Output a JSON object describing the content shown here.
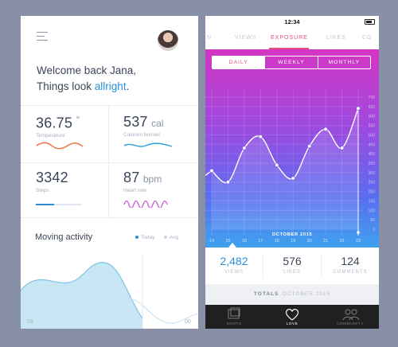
{
  "left": {
    "welcome_line1": "Welcome back Jana,",
    "welcome_line2_prefix": "Things look ",
    "welcome_line2_accent": "allright",
    "welcome_line2_suffix": ".",
    "metrics": [
      {
        "value": "36.75",
        "unit": "°",
        "label": "Temperature"
      },
      {
        "value": "537",
        "unit": "cal",
        "label": "Calories burned"
      },
      {
        "value": "3342",
        "unit": "",
        "label": "Steps"
      },
      {
        "value": "87",
        "unit": "bpm",
        "label": "Heart rate"
      }
    ],
    "moving_activity": {
      "title": "Moving activity",
      "legend_today": "Today",
      "legend_avg": "Avg",
      "x_start": "08",
      "x_end": "00"
    }
  },
  "right": {
    "status_time": "12:34",
    "tabs": [
      "N",
      "VIEWS",
      "EXPOSURE",
      "LIKES",
      "CO"
    ],
    "segments": [
      "DAILY",
      "WEEKLY",
      "MONTHLY"
    ],
    "y_ticks": [
      "700",
      "650",
      "600",
      "550",
      "500",
      "450",
      "400",
      "350",
      "300",
      "250",
      "200",
      "150",
      "100",
      "50",
      "0"
    ],
    "x_ticks": [
      "14",
      "15",
      "16",
      "17",
      "18",
      "19",
      "20",
      "21",
      "22",
      "23"
    ],
    "month_label": "OCTOBER 2015",
    "stats": [
      {
        "value": "2,482",
        "label": "VIEWS"
      },
      {
        "value": "576",
        "label": "LIKES"
      },
      {
        "value": "124",
        "label": "COMMENTS"
      }
    ],
    "totals_prefix": "TOTALS",
    "totals_period": "OCTOBER 2015",
    "nav": [
      "SHOTS",
      "LOVE",
      "COMMUNITY"
    ]
  },
  "colors": {
    "background": "#8790a6",
    "accent_blue": "#2a8fd6",
    "accent_pink": "#e64b85",
    "gradient_top": "#d436c3",
    "gradient_bottom": "#3ea2ee"
  },
  "chart_data": {
    "type": "line",
    "x": [
      14,
      15,
      16,
      17,
      18,
      19,
      20,
      21,
      22,
      23
    ],
    "values": [
      310,
      250,
      430,
      490,
      340,
      270,
      440,
      530,
      430,
      640
    ],
    "ylim": [
      0,
      700
    ]
  }
}
